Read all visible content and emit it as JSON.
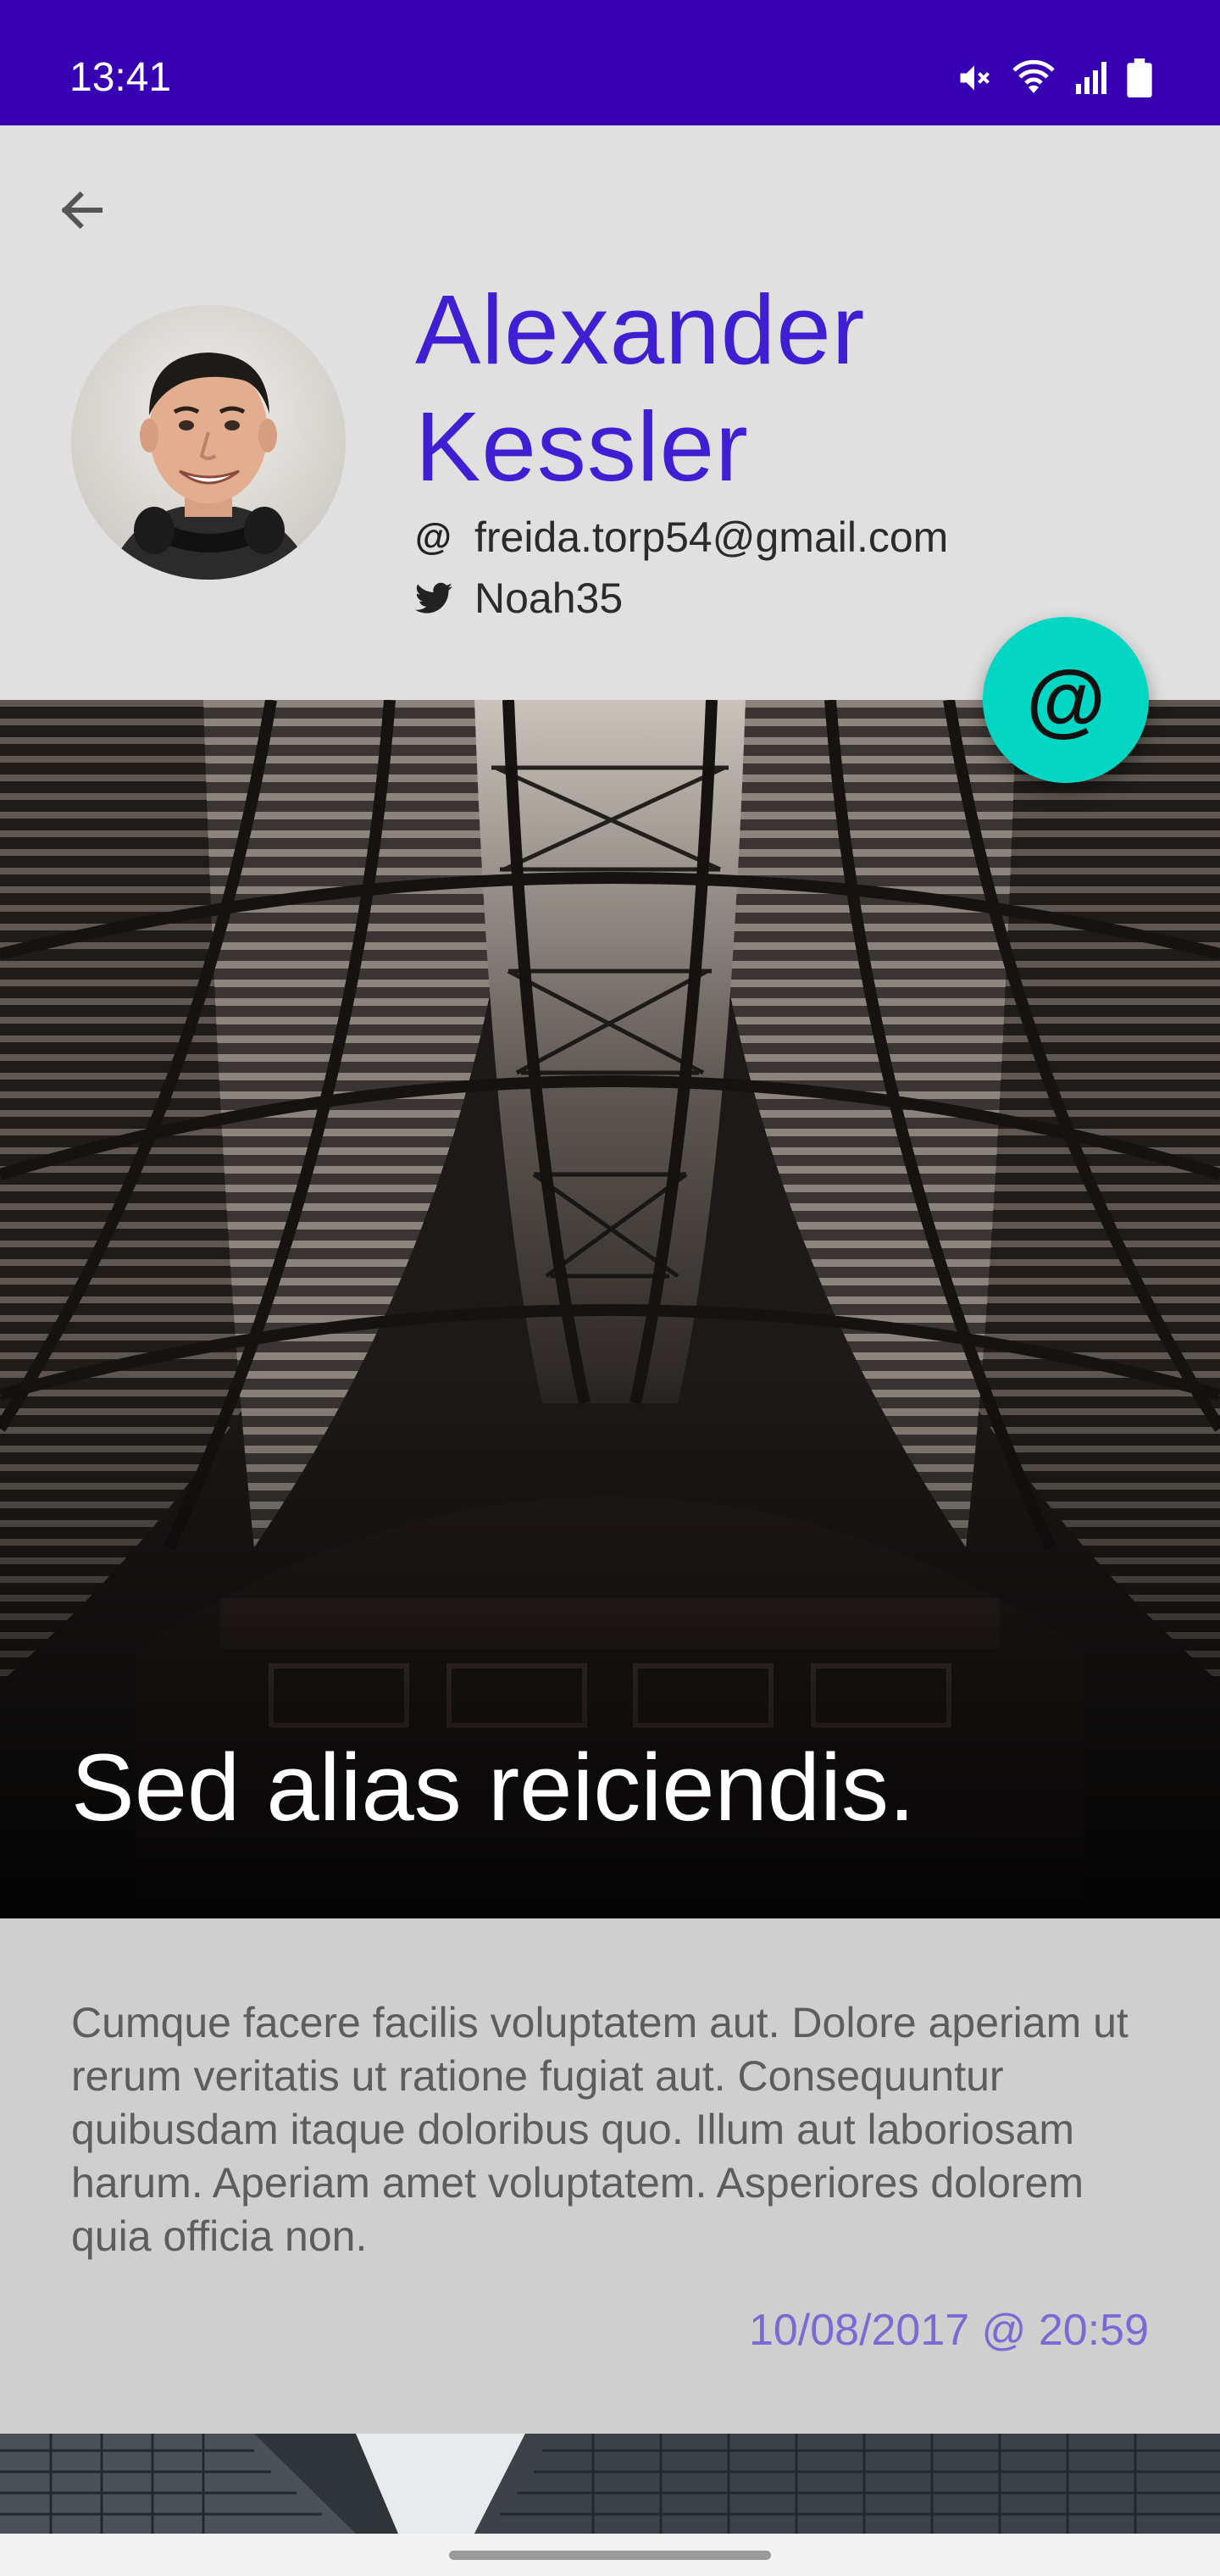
{
  "status_bar": {
    "time": "13:41",
    "background": "#3700b3",
    "icons": [
      "mute-icon",
      "wifi-icon",
      "signal-icon",
      "battery-icon"
    ]
  },
  "header": {
    "back_icon": "arrow-back-icon"
  },
  "profile": {
    "first_name": "Alexander",
    "last_name": "Kessler",
    "email": "freida.torp54@gmail.com",
    "twitter": "Noah35",
    "name_color": "#3f1fd1"
  },
  "fab": {
    "symbol": "@",
    "color": "#03d7c4"
  },
  "post": {
    "title": "Sed alias reiciendis.",
    "body": "Cumque facere facilis voluptatem aut. Dolore aperiam ut rerum veritatis ut ratione fugiat aut. Consequuntur quibusdam itaque doloribus quo. Illum aut laboriosam harum. Aperiam amet voluptatem. Asperiores dolorem quia officia non.",
    "date": "10/08/2017 @ 20:59",
    "date_color": "#7a6ad4"
  }
}
